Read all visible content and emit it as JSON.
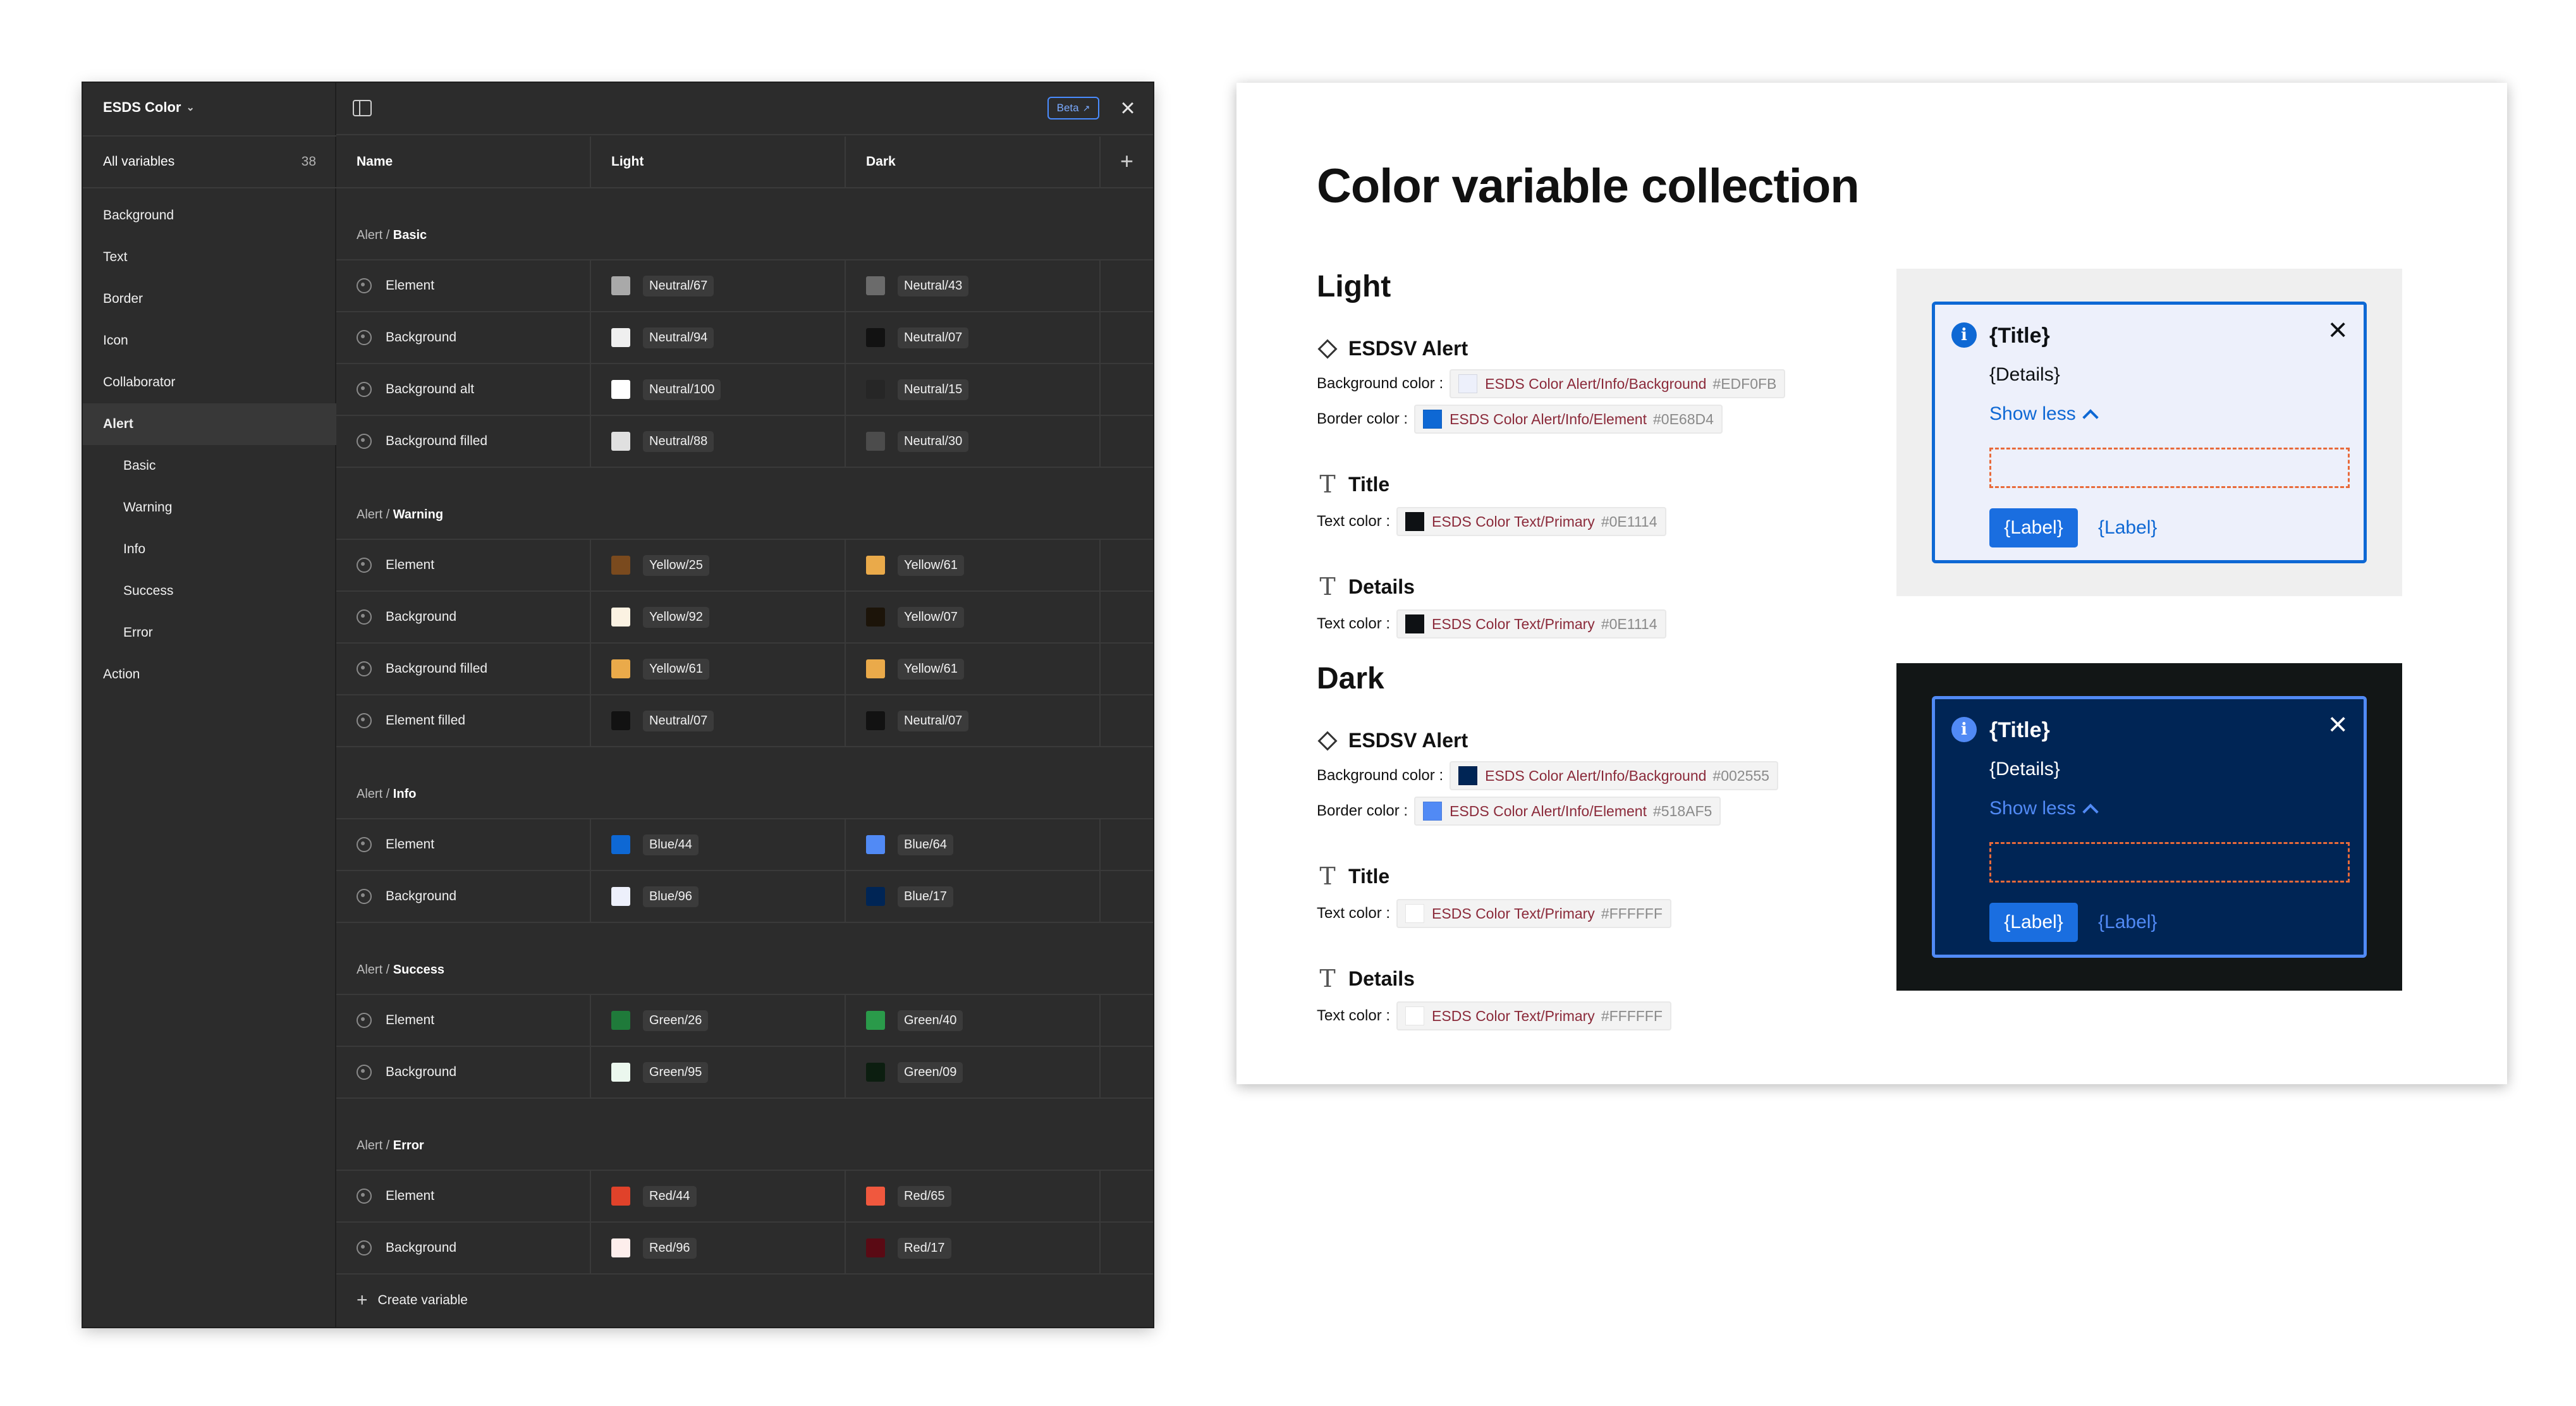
{
  "figma": {
    "collection_title": "ESDS Color",
    "all_variables_label": "All variables",
    "all_variables_count": "38",
    "sidebar": [
      {
        "label": "Background",
        "sub": false,
        "active": false
      },
      {
        "label": "Text",
        "sub": false,
        "active": false
      },
      {
        "label": "Border",
        "sub": false,
        "active": false
      },
      {
        "label": "Icon",
        "sub": false,
        "active": false
      },
      {
        "label": "Collaborator",
        "sub": false,
        "active": false
      },
      {
        "label": "Alert",
        "sub": false,
        "active": true
      },
      {
        "label": "Basic",
        "sub": true,
        "active": false
      },
      {
        "label": "Warning",
        "sub": true,
        "active": false
      },
      {
        "label": "Info",
        "sub": true,
        "active": false
      },
      {
        "label": "Success",
        "sub": true,
        "active": false
      },
      {
        "label": "Error",
        "sub": true,
        "active": false
      },
      {
        "label": "Action",
        "sub": false,
        "active": false
      }
    ],
    "beta_label": "Beta",
    "columns": {
      "name": "Name",
      "light": "Light",
      "dark": "Dark"
    },
    "groups": [
      {
        "prefix": "Alert / ",
        "name": "Basic",
        "rows": [
          {
            "name": "Element",
            "light": {
              "label": "Neutral/67",
              "color": "#a9a9a9"
            },
            "dark": {
              "label": "Neutral/43",
              "color": "#6b6b6b"
            }
          },
          {
            "name": "Background",
            "light": {
              "label": "Neutral/94",
              "color": "#efefef"
            },
            "dark": {
              "label": "Neutral/07",
              "color": "#121212"
            }
          },
          {
            "name": "Background alt",
            "light": {
              "label": "Neutral/100",
              "color": "#ffffff"
            },
            "dark": {
              "label": "Neutral/15",
              "color": "#262626"
            }
          },
          {
            "name": "Background filled",
            "light": {
              "label": "Neutral/88",
              "color": "#e0e0e0"
            },
            "dark": {
              "label": "Neutral/30",
              "color": "#4c4c4c"
            }
          }
        ]
      },
      {
        "prefix": "Alert / ",
        "name": "Warning",
        "rows": [
          {
            "name": "Element",
            "light": {
              "label": "Yellow/25",
              "color": "#7a4a1e"
            },
            "dark": {
              "label": "Yellow/61",
              "color": "#eaaa4a"
            }
          },
          {
            "name": "Background",
            "light": {
              "label": "Yellow/92",
              "color": "#fbf2e2"
            },
            "dark": {
              "label": "Yellow/07",
              "color": "#1c1409"
            }
          },
          {
            "name": "Background filled",
            "light": {
              "label": "Yellow/61",
              "color": "#eaaa4a"
            },
            "dark": {
              "label": "Yellow/61",
              "color": "#eaaa4a"
            }
          },
          {
            "name": "Element filled",
            "light": {
              "label": "Neutral/07",
              "color": "#121212"
            },
            "dark": {
              "label": "Neutral/07",
              "color": "#121212"
            }
          }
        ]
      },
      {
        "prefix": "Alert / ",
        "name": "Info",
        "rows": [
          {
            "name": "Element",
            "light": {
              "label": "Blue/44",
              "color": "#0e68d4"
            },
            "dark": {
              "label": "Blue/64",
              "color": "#518af5"
            }
          },
          {
            "name": "Background",
            "light": {
              "label": "Blue/96",
              "color": "#edf0fb"
            },
            "dark": {
              "label": "Blue/17",
              "color": "#002555"
            }
          }
        ]
      },
      {
        "prefix": "Alert / ",
        "name": "Success",
        "rows": [
          {
            "name": "Element",
            "light": {
              "label": "Green/26",
              "color": "#1f7a3a"
            },
            "dark": {
              "label": "Green/40",
              "color": "#2a9a4a"
            }
          },
          {
            "name": "Background",
            "light": {
              "label": "Green/95",
              "color": "#ebf7ee"
            },
            "dark": {
              "label": "Green/09",
              "color": "#0c1e10"
            }
          }
        ]
      },
      {
        "prefix": "Alert / ",
        "name": "Error",
        "rows": [
          {
            "name": "Element",
            "light": {
              "label": "Red/44",
              "color": "#e0422a"
            },
            "dark": {
              "label": "Red/65",
              "color": "#f0583e"
            }
          },
          {
            "name": "Background",
            "light": {
              "label": "Red/96",
              "color": "#fdeeec"
            },
            "dark": {
              "label": "Red/17",
              "color": "#5a0a14"
            }
          }
        ]
      }
    ],
    "create_variable_label": "Create variable"
  },
  "doc": {
    "title": "Color variable collection",
    "sections": [
      {
        "heading": "Light",
        "alert_heading": "ESDSV Alert",
        "bg_label": "Background color :",
        "bg_token": "ESDS Color Alert/Info/Background",
        "bg_hex": "#EDF0FB",
        "bg_color": "#EDF0FB",
        "border_label": "Border color :",
        "border_token": "ESDS Color Alert/Info/Element",
        "border_hex": "#0E68D4",
        "border_color": "#0E68D4",
        "title_heading": "Title",
        "title_text_label": "Text color :",
        "title_token": "ESDS Color Text/Primary",
        "title_hex": "#0E1114",
        "title_color": "#0E1114",
        "details_heading": "Details",
        "details_text_label": "Text color :",
        "details_token": "ESDS Color Text/Primary",
        "details_hex": "#0E1114",
        "details_color": "#0E1114",
        "preview": {
          "outer_bg": "#efefef",
          "alert_bg": "#EDF0FB",
          "alert_border": "#0E68D4",
          "text_color": "#0E1114",
          "link_color": "#0E68D4",
          "icon_color": "#0E68D4",
          "title": "{Title}",
          "details": "{Details}",
          "show_less": "Show less",
          "primary_button": "{Label}",
          "link_button": "{Label}"
        }
      },
      {
        "heading": "Dark",
        "alert_heading": "ESDSV Alert",
        "bg_label": "Background color :",
        "bg_token": "ESDS Color Alert/Info/Background",
        "bg_hex": "#002555",
        "bg_color": "#002555",
        "border_label": "Border color :",
        "border_token": "ESDS Color Alert/Info/Element",
        "border_hex": "#518AF5",
        "border_color": "#518AF5",
        "title_heading": "Title",
        "title_text_label": "Text color :",
        "title_token": "ESDS Color Text/Primary",
        "title_hex": "#FFFFFF",
        "title_color": "#FFFFFF",
        "details_heading": "Details",
        "details_text_label": "Text color :",
        "details_token": "ESDS Color Text/Primary",
        "details_hex": "#FFFFFF",
        "details_color": "#FFFFFF",
        "preview": {
          "outer_bg": "#121616",
          "alert_bg": "#002555",
          "alert_border": "#518AF5",
          "text_color": "#FFFFFF",
          "link_color": "#518AF5",
          "icon_color": "#518AF5",
          "title": "{Title}",
          "details": "{Details}",
          "show_less": "Show less",
          "primary_button": "{Label}",
          "link_button": "{Label}"
        }
      }
    ]
  }
}
